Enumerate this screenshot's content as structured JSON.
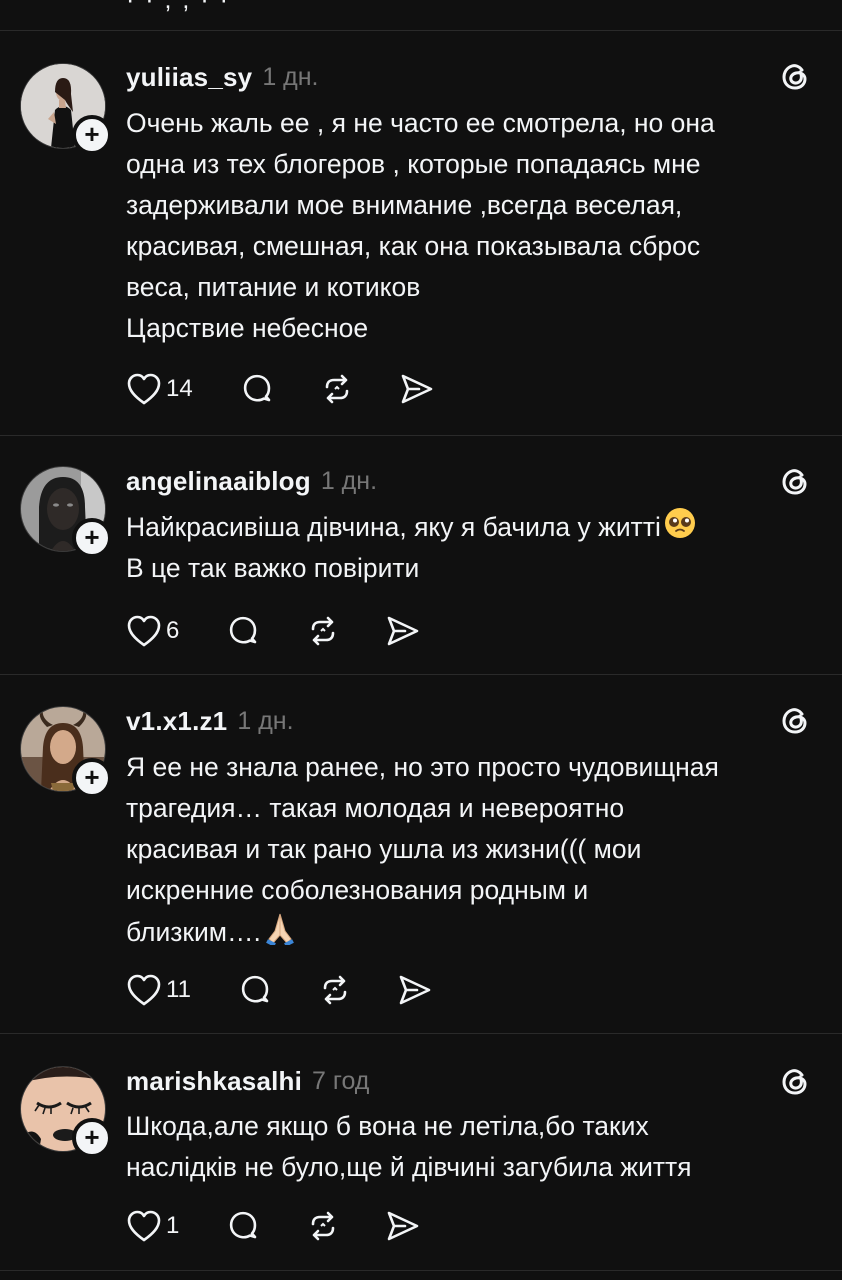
{
  "posts": [
    {
      "username": "yuliias_sy",
      "time": "1 дн.",
      "lines": [
        "Очень жаль ее ,  я не часто ее смотрела, но она",
        "одна из тех блогеров , которые попадаясь мне",
        "задерживали мое внимание ,всегда веселая,",
        "красивая, смешная, как она показывала сброс",
        "веса, питание и котиков",
        "Царствие небесное"
      ],
      "likes": "14",
      "avatar_icon": "woman-black-dress-avatar"
    },
    {
      "username": "angelinaaiblog",
      "time": "1 дн.",
      "lines": [
        "Найкрасивіша дівчина, яку я бачила у житті",
        "В це так важко повірити"
      ],
      "emoji": "pleading-face-emoji",
      "likes": "6",
      "avatar_icon": "dark-woman-portrait-avatar"
    },
    {
      "username": "v1.x1.z1",
      "time": "1 дн.",
      "lines": [
        "Я ее не знала ранее, но это просто чудовищная",
        "трагедия… такая молодая и невероятно",
        "красивая и так рано ушла из жизни((( мои",
        "искренние соболезнования родным и",
        "близким…."
      ],
      "emoji": "folded-hands-emoji",
      "likes": "11",
      "avatar_icon": "horned-woman-avatar"
    },
    {
      "username": "marishkasalhi",
      "time": "7 год",
      "lines": [
        "Шкода,але якщо б вона не летіла,бо таких",
        "наслідків не було,ще й дівчині загубила життя"
      ],
      "likes": "1",
      "avatar_icon": "closed-eyes-face-avatar"
    }
  ]
}
